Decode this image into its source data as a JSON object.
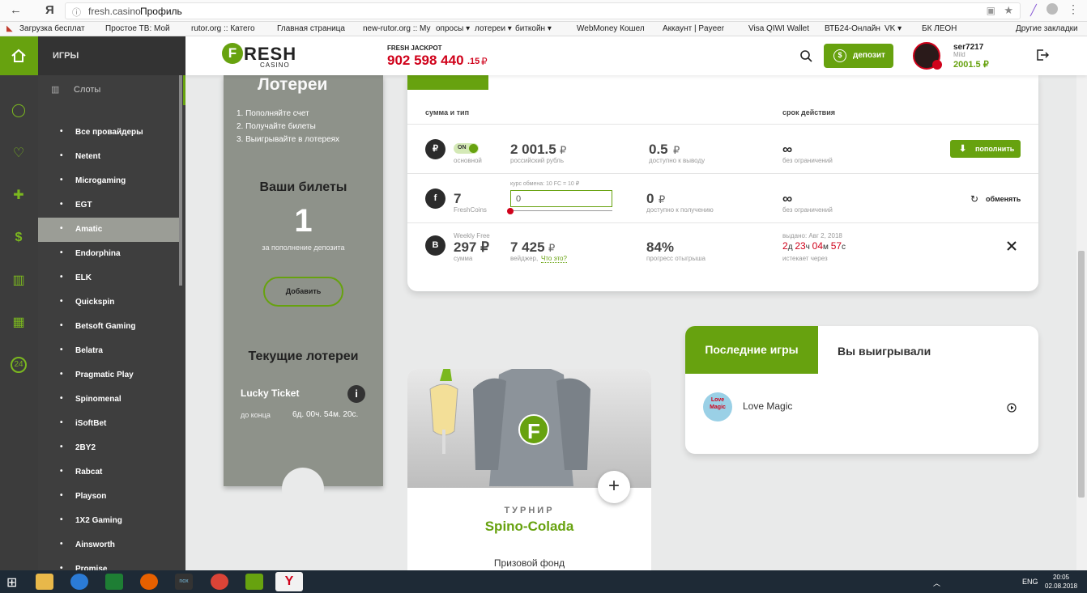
{
  "browser": {
    "back": "←",
    "yandex": "Я",
    "url_host": "fresh.casino",
    "url_title": "Профиль",
    "bookmarks": [
      "Загрузка бесплат",
      "Простое ТВ: Мой",
      "rutor.org :: Катего",
      "Главная страница",
      "new-rutor.org :: Му",
      "опросы ▾",
      "лотереи ▾",
      "биткойн ▾",
      "WebMoney Кошел",
      "Аккаунт | Payeer",
      "Visa QIWI Wallet",
      "ВТБ24-Онлайн",
      "VK ▾",
      "БК ЛЕОН",
      "Другие закладки"
    ]
  },
  "header": {
    "logo_main": "RESH",
    "logo_letter": "F",
    "logo_sub": "CASINO",
    "jackpot_label": "FRESH JACKPOT",
    "jackpot_value": "902 598 440",
    "jackpot_cents": ".15",
    "jackpot_currency": "₽",
    "deposit_label": "депозит",
    "username": "ser7217",
    "level": "Mild",
    "balance": "2001.5 ₽"
  },
  "sidebar": {
    "games_label": "ИГРЫ",
    "slots_label": "Слоты",
    "providers": [
      "Все провайдеры",
      "Netent",
      "Microgaming",
      "EGT",
      "Amatic",
      "Endorphina",
      "ELK",
      "Quickspin",
      "Betsoft Gaming",
      "Belatra",
      "Pragmatic Play",
      "Spinomenal",
      "iSoftBet",
      "2BY2",
      "Rabcat",
      "Playson",
      "1X2 Gaming",
      "Ainsworth",
      "Promise"
    ],
    "active_provider": "Amatic"
  },
  "lottery": {
    "title": "Лотереи",
    "steps": [
      "1.  Пополняйте счет",
      "2.  Получайте билеты",
      "3.  Выигрывайте в лотереях"
    ],
    "tickets_title": "Ваши билеты",
    "tickets_count": "1",
    "tickets_note": "за пополнение депозита",
    "add_button": "Добавить",
    "current_title": "Текущие лотереи",
    "lucky_name": "Lucky Ticket",
    "lucky_left_label": "до конца",
    "lucky_left_value": "6д. 00ч. 54м. 20с."
  },
  "wallet": {
    "col_type": "сумма и тип",
    "col_validity": "срок действия",
    "rows": [
      {
        "icon": "₽",
        "toggle": "ON",
        "type_label": "основной",
        "amount": "2 001.5",
        "amount_cur": "₽",
        "amount_sub": "российский рубль",
        "withdraw": "0.5",
        "withdraw_cur": "₽",
        "withdraw_sub": "доступно к выводу",
        "validity": "∞",
        "validity_sub": "без ограничений",
        "action": "пополнить"
      },
      {
        "icon": "f",
        "amount": "7",
        "type_label": "FreshCoins",
        "rate_label": "курс обмена: 10 FC = 10 ₽",
        "input_value": "0",
        "receive": "0",
        "receive_cur": "₽",
        "receive_sub": "доступно к получению",
        "validity": "∞",
        "validity_sub": "без ограничений",
        "action": "обменять"
      },
      {
        "icon": "B",
        "name": "Weekly Free",
        "amount": "297 ₽",
        "type_label": "сумма",
        "wager": "7 425",
        "wager_cur": "₽",
        "wager_sub": "вейджер,",
        "wager_link": "Что это?",
        "progress": "84%",
        "progress_sub": "прогресс отыгрыша",
        "issued": "выдано: Авг 2, 2018",
        "expires_d": "2",
        "expires_h": "23",
        "expires_m": "04",
        "expires_s": "57",
        "expires_sub": "истекает через"
      }
    ]
  },
  "tournament": {
    "badge": "F",
    "label": "ТУРНИР",
    "name": "Spino-Colada",
    "prize_label": "Призовой фонд",
    "plus": "+"
  },
  "recent": {
    "tab_active": "Последние игры",
    "tab_other": "Вы выигрывали",
    "game_name": "Love Magic",
    "game_logo_text": "Love Magic"
  },
  "taskbar": {
    "lang": "ENG",
    "time": "20:05",
    "date": "02.08.2018"
  },
  "colors": {
    "accent": "#67a20f",
    "dark": "#3c3c3c",
    "red": "#d0021b"
  }
}
